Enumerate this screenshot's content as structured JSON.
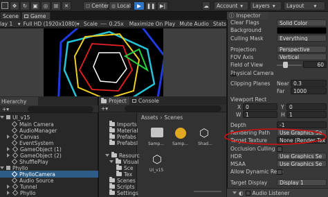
{
  "toolbar": {
    "tab_scene": "Scene",
    "tab_game": "Game",
    "pivot": "Center",
    "space": "Local",
    "account": "Account",
    "layers": "Layers",
    "layout": "Layout"
  },
  "game_toolbar": {
    "display": "lay 1",
    "resolution": "Full HD (1920x1080)",
    "scale_label": "Scale",
    "scale_value": "0.25x",
    "maximize": "Maximize On Play",
    "mute": "Mute Audio",
    "stats": "Stats"
  },
  "inspector": {
    "title": "Inspector",
    "clear_flags_label": "Clear Flags",
    "clear_flags_value": "Solid Color",
    "background_label": "Background",
    "culling_mask_label": "Culling Mask",
    "culling_mask_value": "Everything",
    "projection_label": "Projection",
    "projection_value": "Perspective",
    "fov_axis_label": "FOV Axis",
    "fov_axis_value": "Vertical",
    "fov_label": "Field of View",
    "fov_value": "60",
    "fov_fraction": 0.33,
    "physical_camera_label": "Physical Camera",
    "clipping_label": "Clipping Planes",
    "near_label": "Near",
    "near_value": "0.3",
    "far_label": "Far",
    "far_value": "1000",
    "viewport_label": "Viewport Rect",
    "vx_label": "X",
    "vx_value": "0",
    "vy_label": "Y",
    "vy_value": "0",
    "vw_label": "W",
    "vw_value": "1",
    "vh_label": "H",
    "vh_value": "1",
    "depth_label": "Depth",
    "depth_value": "-1",
    "rendering_path_label": "Rendering Path",
    "rendering_path_value": "Use Graphics Se",
    "target_texture_label": "Target Texture",
    "target_texture_value": "None (Render Tex",
    "occlusion_label": "Occlusion Culling",
    "hdr_label": "HDR",
    "hdr_value": "Use Graphics Se",
    "msaa_label": "MSAA",
    "msaa_value": "Use Graphics Se",
    "dynres_label": "Allow Dynamic Reso",
    "target_display_label": "Target Display",
    "target_display_value": "Display 1",
    "audio_listener": "Audio Listener"
  },
  "hierarchy": {
    "title": "Hierarchy",
    "items": [
      "UI_v15",
      "Main Camera",
      "AudioManager",
      "Canvas",
      "EventSystem",
      "GameObject (1)",
      "GameObject (2)",
      "ShufflePlay",
      "Phyllo",
      "PhylloCamera",
      "Audio Source",
      "Tunnel",
      "Phyllo"
    ]
  },
  "project": {
    "tab_project": "Project",
    "tab_console": "Console",
    "breadcrumb_assets": "Assets",
    "breadcrumb_scenes": "Scenes",
    "folders": [
      "Imports",
      "Material",
      "Prefabs",
      "Prefabsl",
      "Resourc",
      "Visual",
      "Sce",
      "Tex",
      "Scenes",
      "Scripts",
      "Settings"
    ],
    "assets": [
      "Samp...",
      "Samp...",
      "Shad...",
      "UI_v15"
    ]
  },
  "colors": {
    "accent": "#2d74c6",
    "annotation": "#d01010"
  }
}
